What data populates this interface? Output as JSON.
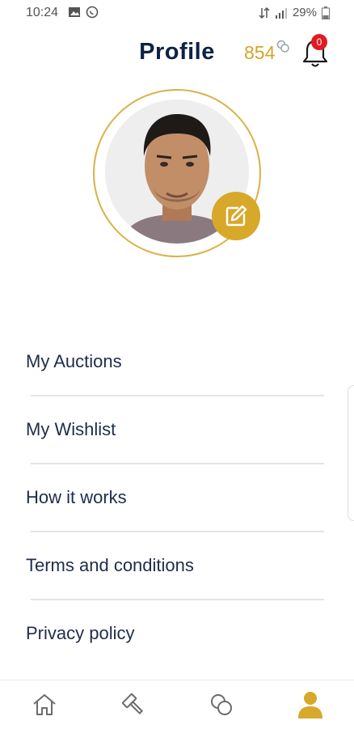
{
  "status_bar": {
    "time": "10:24",
    "battery": "29%",
    "icons_left": [
      "image-icon",
      "whatsapp-icon"
    ],
    "icons_right": [
      "data-icon",
      "signal-icon",
      "battery-icon"
    ]
  },
  "header": {
    "title": "Profile",
    "coins": "854",
    "notifications_count": "0"
  },
  "menu": {
    "items": [
      {
        "label": "My Auctions"
      },
      {
        "label": "My Wishlist"
      },
      {
        "label": "How it works"
      },
      {
        "label": "Terms and conditions"
      },
      {
        "label": "Privacy policy"
      }
    ]
  },
  "bottom_nav": {
    "items": [
      "home-icon",
      "auction-hammer-icon",
      "coins-icon",
      "profile-icon"
    ],
    "active": "profile-icon"
  },
  "colors": {
    "accent": "#d8a82a",
    "title": "#0e2246",
    "badge": "#e01b24",
    "nav_inactive": "#6b6b6b"
  }
}
